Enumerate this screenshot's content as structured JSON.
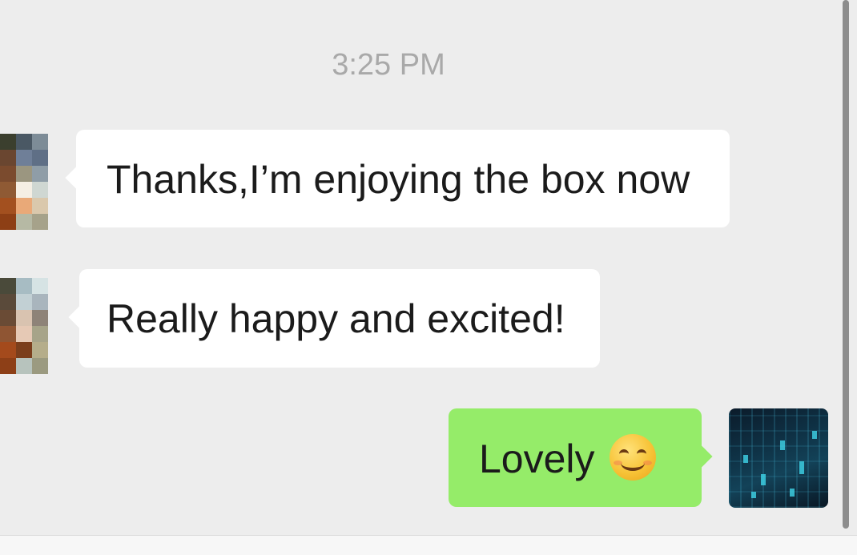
{
  "chat": {
    "timestamp": "3:25 PM",
    "messages": [
      {
        "direction": "incoming",
        "text": "Thanks,I’m enjoying the box now"
      },
      {
        "direction": "incoming",
        "text": "Really happy and excited!"
      },
      {
        "direction": "outgoing",
        "text": "Lovely",
        "emoji": "smiling-face-with-smiling-eyes"
      }
    ]
  },
  "avatars": {
    "contact_1": [
      "#3b3f2e",
      "#4a5864",
      "#7d8c97",
      "#6a4630",
      "#6f7f98",
      "#5f6f86",
      "#7b4b2e",
      "#9b9680",
      "#8f9da7",
      "#8f5a34",
      "#f5efe4",
      "#cfd7d2",
      "#a3501f",
      "#e9a978",
      "#dac8ac",
      "#8d3f15",
      "#b6b9a4",
      "#a6a28a"
    ],
    "contact_2": [
      "#4a4a3a",
      "#a7bcc3",
      "#d6e3e4",
      "#5a4a3a",
      "#c2d0d4",
      "#a9b5bd",
      "#6a4b35",
      "#d9c3b0",
      "#8e8378",
      "#8f5533",
      "#e6c9b5",
      "#a7a489",
      "#a44a1c",
      "#7b3e1c",
      "#b5ad8a",
      "#8d3f17",
      "#b7c3bd",
      "#9b9a80"
    ]
  },
  "colors": {
    "background": "#ededed",
    "incoming_bubble": "#ffffff",
    "outgoing_bubble": "#95ec69",
    "timestamp_text": "#a9a9a9"
  },
  "icons": {
    "self_avatar": "city-night-avatar-icon"
  }
}
